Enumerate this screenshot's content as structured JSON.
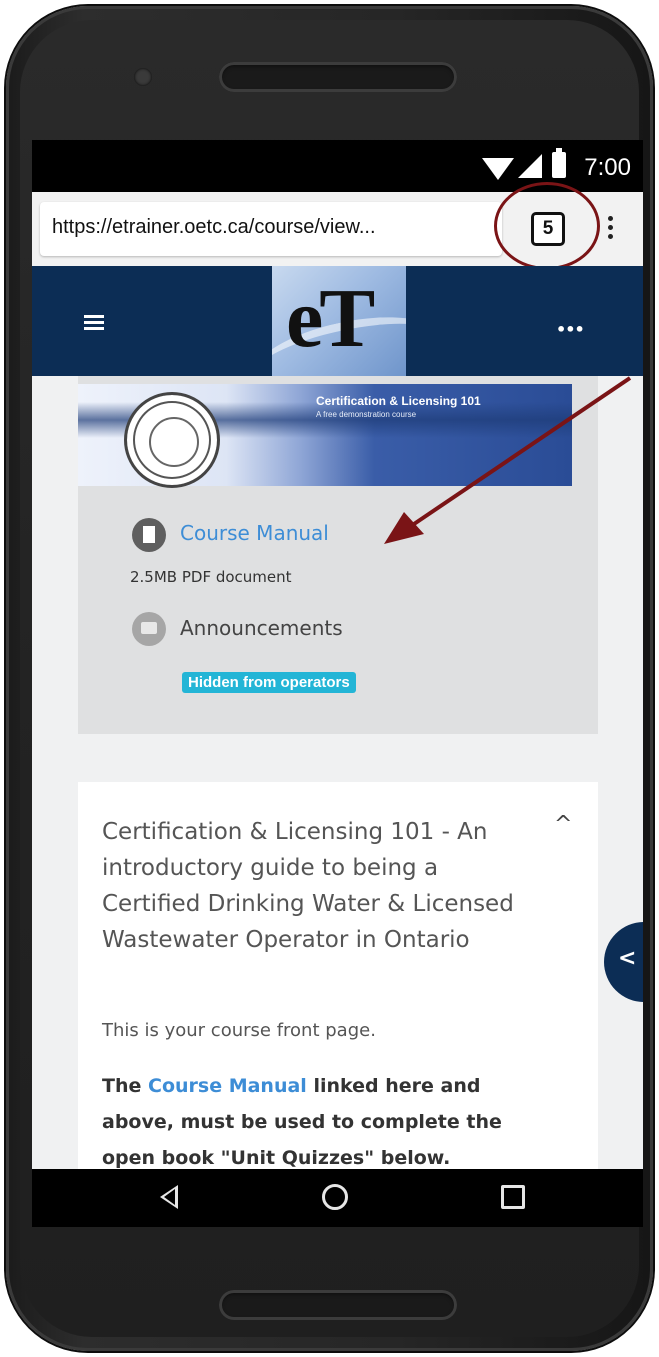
{
  "statusbar": {
    "time": "7:00"
  },
  "browser": {
    "url": "https://etrainer.oetc.ca/course/view...",
    "tab_count": "5"
  },
  "navbar": {
    "logo_text": "eT",
    "more_label": "•••"
  },
  "banner": {
    "title": "Certification & Licensing 101",
    "subtitle": "A free demonstration course"
  },
  "resources": {
    "manual_label": "Course Manual",
    "manual_meta": "2.5MB PDF document",
    "announcements_label": "Announcements",
    "hidden_badge": "Hidden from operators"
  },
  "section": {
    "title": "Certification & Licensing 101 - An introductory guide to being a Certified Drinking Water & Licensed Wastewater Operator in Ontario",
    "front_page_text": "This is your course front page.",
    "para_intro": "The ",
    "para_link": "Course Manual",
    "para_rest": " linked here and above, must be used to complete the open book \"Unit Quizzes\" below."
  },
  "colors": {
    "navbar_bg": "#0c2d55",
    "link": "#3d8dd6",
    "badge": "#23b5d6",
    "annotation": "#7a1416"
  }
}
